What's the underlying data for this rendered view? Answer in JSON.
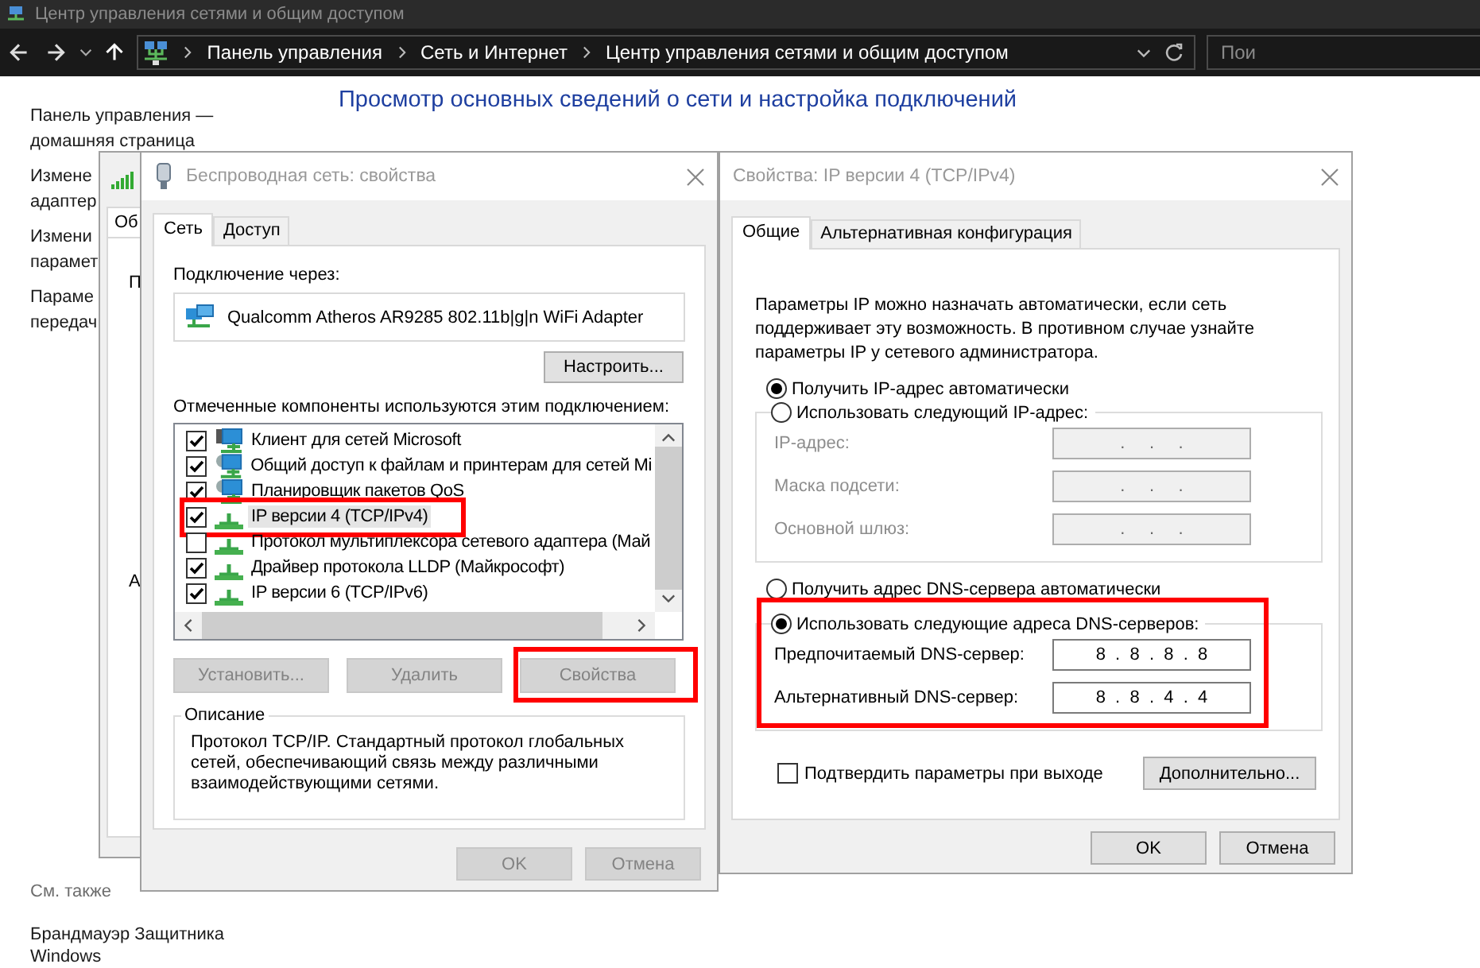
{
  "window": {
    "title": "Центр управления сетями и общим доступом"
  },
  "address_bar": {
    "breadcrumbs": [
      "Панель управления",
      "Сеть и Интернет",
      "Центр управления сетями и общим доступом"
    ],
    "search": {
      "placeholder": "Пои"
    }
  },
  "sidebar": {
    "links": [
      "Панель управления —\nдомашняя страница",
      "Измене\nадаптер",
      "Измени\nпарамет",
      "Параме\nпередач"
    ],
    "see_also_title": "См. также",
    "see_also_links": [
      "Брандмауэр Защитника\nWindows"
    ]
  },
  "heading": "Просмотр основных сведений о сети и настройка подключений",
  "background_window": {
    "tab": "Об",
    "texts": [
      "П",
      "А"
    ]
  },
  "adapter_dialog": {
    "title": "Беспроводная сеть: свойства",
    "tabs": [
      {
        "label": "Сеть",
        "selected": true
      },
      {
        "label": "Доступ",
        "selected": false
      }
    ],
    "connect_label": "Подключение через:",
    "adapter": "Qualcomm Atheros AR9285 802.11b|g|n WiFi Adapter",
    "configure_button": "Настроить...",
    "components_label": "Отмеченные компоненты используются этим подключением:",
    "components": [
      {
        "name": "Клиент для сетей Microsoft",
        "kind": "client",
        "checked": true,
        "selected": false,
        "highlighted": false
      },
      {
        "name": "Общий доступ к файлам и принтерам для сетей Mi",
        "kind": "service",
        "checked": true,
        "selected": false,
        "highlighted": false
      },
      {
        "name": "Планировщик пакетов QoS",
        "kind": "service",
        "checked": true,
        "selected": false,
        "highlighted": false
      },
      {
        "name": "IP версии 4 (TCP/IPv4)",
        "kind": "protocol",
        "checked": true,
        "selected": true,
        "highlighted": true
      },
      {
        "name": "Протокол мультиплексора сетевого адаптера (Май",
        "kind": "protocol",
        "checked": false,
        "selected": false,
        "highlighted": false
      },
      {
        "name": "Драйвер протокола LLDP (Майкрософт)",
        "kind": "protocol",
        "checked": true,
        "selected": false,
        "highlighted": false
      },
      {
        "name": "IP версии 6 (TCP/IPv6)",
        "kind": "protocol",
        "checked": true,
        "selected": false,
        "highlighted": false
      }
    ],
    "buttons": [
      {
        "label": "Установить...",
        "disabled": true,
        "highlighted": false
      },
      {
        "label": "Удалить",
        "disabled": true,
        "highlighted": false
      },
      {
        "label": "Свойства",
        "disabled": true,
        "highlighted": true
      }
    ],
    "description_title": "Описание",
    "description": "Протокол TCP/IP. Стандартный протокол глобальных сетей, обеспечивающий связь между различными взаимодействующими сетями.",
    "footer_buttons": [
      {
        "label": "OK",
        "disabled": true
      },
      {
        "label": "Отмена",
        "disabled": true
      }
    ]
  },
  "ipv4_dialog": {
    "title": "Свойства: IP версии 4 (TCP/IPv4)",
    "tabs": [
      {
        "label": "Общие",
        "selected": true
      },
      {
        "label": "Альтернативная конфигурация",
        "selected": false
      }
    ],
    "intro": "Параметры IP можно назначать автоматически, если сеть поддерживает эту возможность. В противном случае узнайте параметры IP у сетевого администратора.",
    "ip_options": [
      {
        "label": "Получить IP-адрес автоматически",
        "selected": true
      },
      {
        "label": "Использовать следующий IP-адрес:",
        "selected": false
      }
    ],
    "ip_fields": [
      {
        "label": "IP-адрес:",
        "value": ".     .     .",
        "disabled": true
      },
      {
        "label": "Маска подсети:",
        "value": ".     .     .",
        "disabled": true
      },
      {
        "label": "Основной шлюз:",
        "value": ".     .     .",
        "disabled": true
      }
    ],
    "dns": {
      "highlighted": true,
      "options": [
        {
          "label": "Получить адрес DNS-сервера автоматически",
          "selected": false
        },
        {
          "label": "Использовать следующие адреса DNS-серверов:",
          "selected": true
        }
      ],
      "fields": [
        {
          "label": "Предпочитаемый DNS-сервер:",
          "value": "8  .  8  .  8  .  8",
          "disabled": false
        },
        {
          "label": "Альтернативный DNS-сервер:",
          "value": "8  .  8  .  4  .  4",
          "disabled": false
        }
      ]
    },
    "validate": {
      "label": "Подтвердить параметры при выходе",
      "checked": false
    },
    "advanced_button": "Дополнительно...",
    "footer_buttons": [
      {
        "label": "OK",
        "disabled": false
      },
      {
        "label": "Отмена",
        "disabled": false
      }
    ]
  }
}
